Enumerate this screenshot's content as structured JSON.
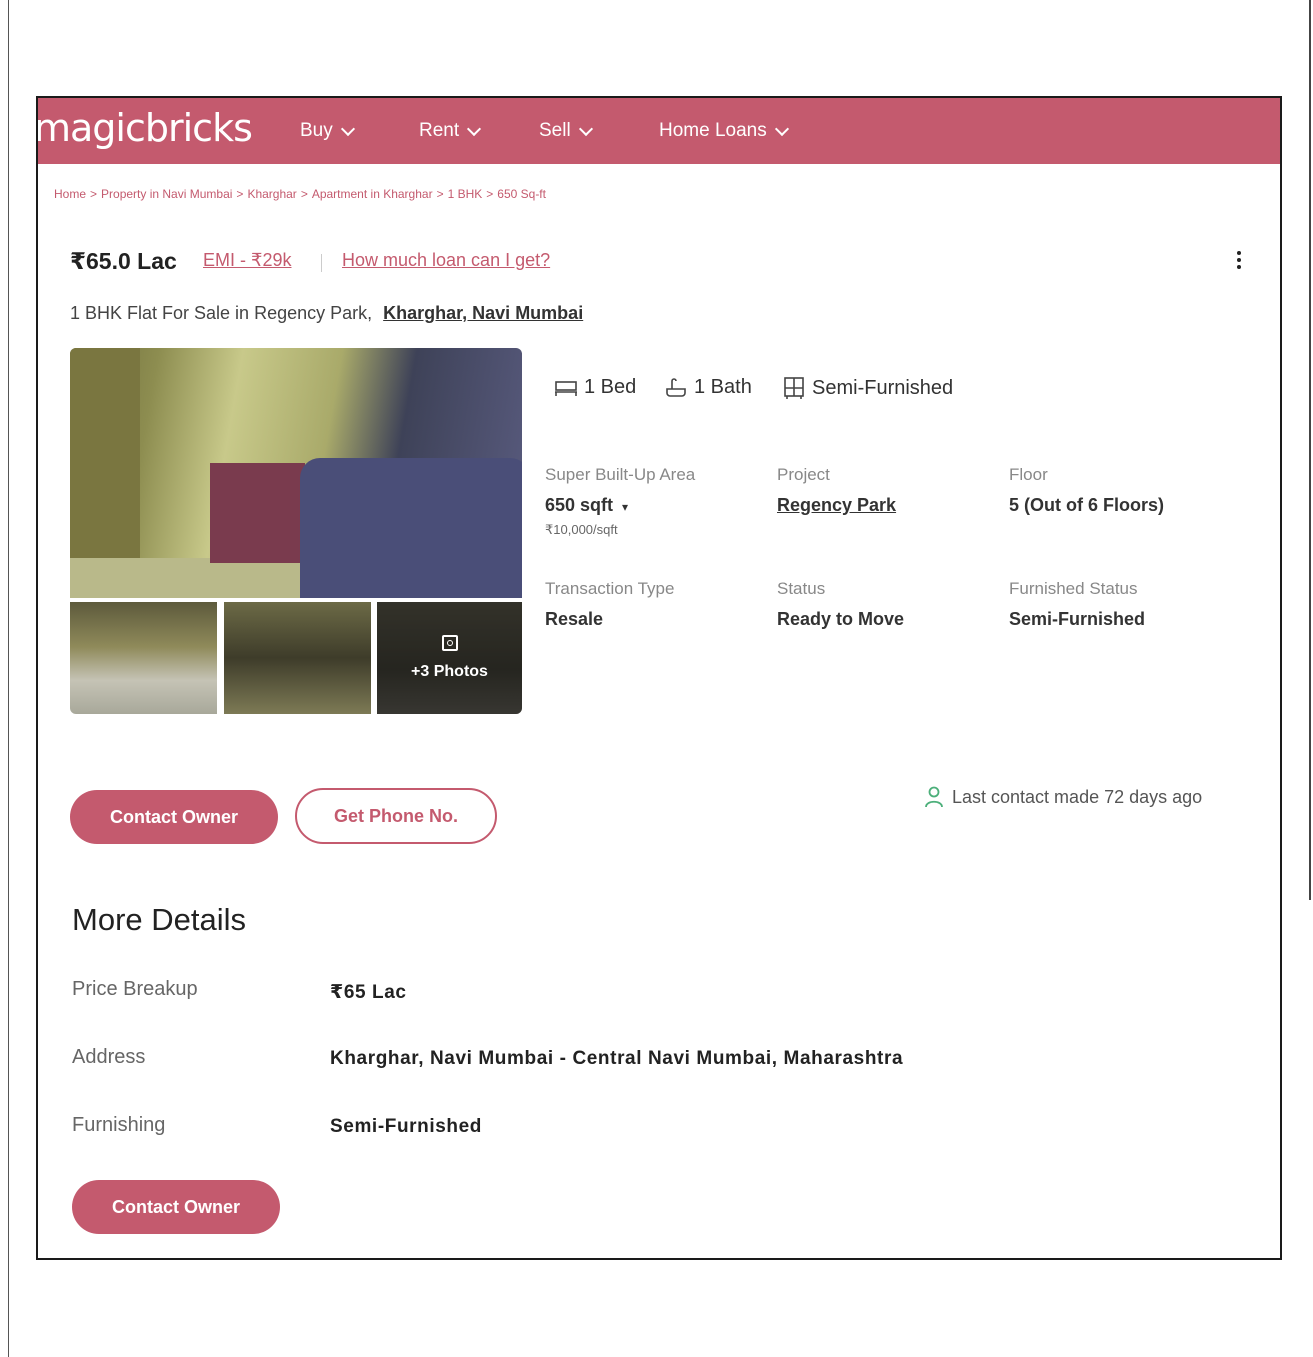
{
  "header": {
    "logo": "magicbricks",
    "nav": [
      {
        "label": "Buy"
      },
      {
        "label": "Rent"
      },
      {
        "label": "Sell"
      },
      {
        "label": "Home Loans"
      }
    ]
  },
  "breadcrumb": [
    "Home",
    "Property in Navi Mumbai",
    "Kharghar",
    "Apartment in Kharghar",
    "1 BHK",
    "650 Sq-ft"
  ],
  "listing": {
    "price": "₹65.0 Lac",
    "emi": "EMI - ₹29k",
    "loan_link": "How much loan can I get?",
    "subtitle": "1 BHK Flat For Sale in Regency Park,",
    "location_link": "Kharghar, Navi Mumbai"
  },
  "photos": {
    "more_label": "+3 Photos"
  },
  "amenities": [
    {
      "icon": "bed-icon",
      "label": "1 Bed"
    },
    {
      "icon": "bath-icon",
      "label": "1 Bath"
    },
    {
      "icon": "furnished-icon",
      "label": "Semi-Furnished"
    }
  ],
  "specs": {
    "area_label": "Super Built-Up Area",
    "area_value": "650 sqft",
    "area_rate": "₹10,000/sqft",
    "project_label": "Project",
    "project_value": "Regency Park",
    "floor_label": "Floor",
    "floor_value": "5 (Out of 6 Floors)",
    "transaction_label": "Transaction Type",
    "transaction_value": "Resale",
    "status_label": "Status",
    "status_value": "Ready to Move",
    "furnished_label": "Furnished Status",
    "furnished_value": "Semi-Furnished"
  },
  "actions": {
    "contact_owner": "Contact Owner",
    "get_phone": "Get Phone No.",
    "last_contact": "Last contact made 72 days ago"
  },
  "more_details": {
    "title": "More Details",
    "rows": [
      {
        "label": "Price Breakup",
        "value": "₹65 Lac"
      },
      {
        "label": "Address",
        "value": "Kharghar, Navi Mumbai - Central Navi Mumbai, Maharashtra"
      },
      {
        "label": "Furnishing",
        "value": "Semi-Furnished"
      }
    ],
    "contact_owner": "Contact Owner"
  },
  "colors": {
    "brand": "#c45a6e",
    "text": "#222222",
    "muted": "#888888"
  }
}
